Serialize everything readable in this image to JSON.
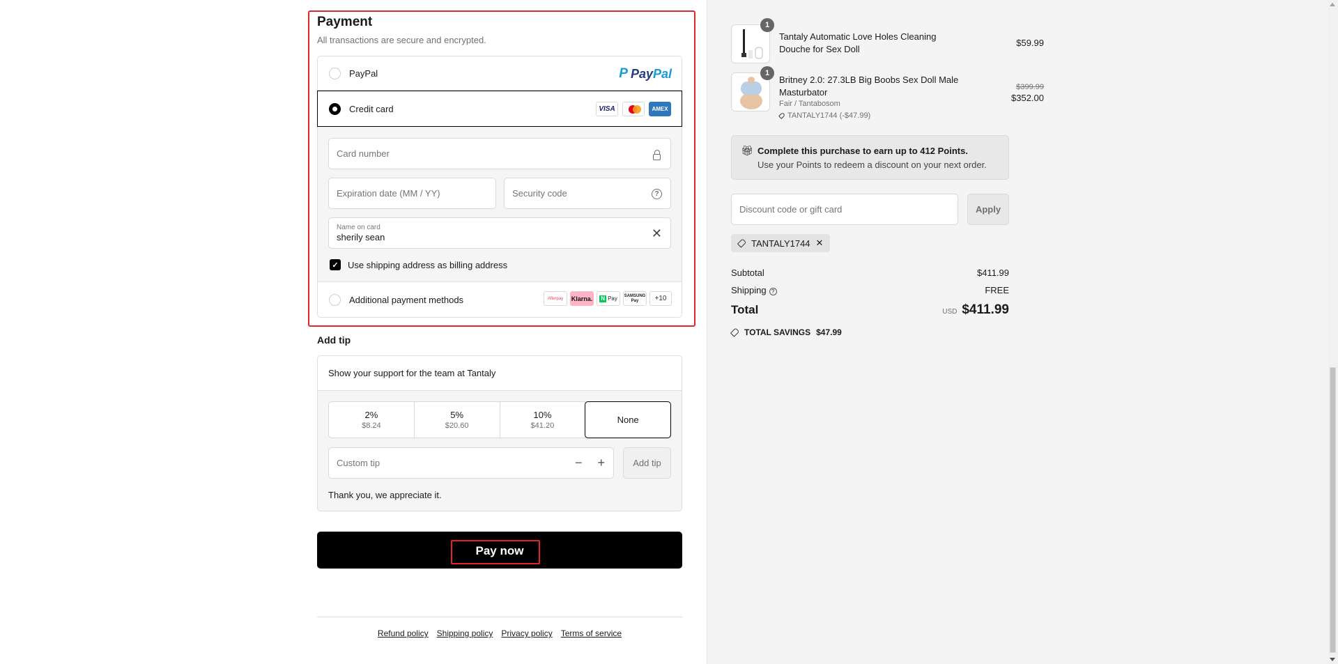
{
  "payment": {
    "title": "Payment",
    "subtitle": "All transactions are secure and encrypted.",
    "methods": {
      "paypal": {
        "label": "PayPal",
        "logo_text_pay": "Pay",
        "logo_text_pal": "Pal"
      },
      "credit_card": {
        "label": "Credit card",
        "selected": true,
        "card_logos": [
          "VISA",
          "mastercard",
          "AMEX"
        ]
      },
      "additional": {
        "label": "Additional payment methods",
        "logos": [
          "Afterpay",
          "Klarna.",
          "Pay",
          "SAMSUNG Pay",
          "+10"
        ]
      }
    },
    "fields": {
      "card_number_placeholder": "Card number",
      "expiration_placeholder": "Expiration date (MM / YY)",
      "security_placeholder": "Security code",
      "name_label": "Name on card",
      "name_value": "sherily sean"
    },
    "billing_checkbox_label": "Use shipping address as billing address",
    "billing_checked": true
  },
  "tip": {
    "title": "Add tip",
    "support_text": "Show your support for the team at Tantaly",
    "options": [
      {
        "pct": "2%",
        "amount": "$8.24"
      },
      {
        "pct": "5%",
        "amount": "$20.60"
      },
      {
        "pct": "10%",
        "amount": "$41.20"
      },
      {
        "pct": "None",
        "amount": ""
      }
    ],
    "selected": "None",
    "custom_placeholder": "Custom tip",
    "add_button": "Add tip",
    "thanks": "Thank you, we appreciate it."
  },
  "pay_button": "Pay now",
  "footer_links": [
    "Refund policy",
    "Shipping policy",
    "Privacy policy",
    "Terms of service"
  ],
  "summary": {
    "items": [
      {
        "qty": "1",
        "name": "Tantaly Automatic Love Holes Cleaning Douche for Sex Doll",
        "price": "$59.99"
      },
      {
        "qty": "1",
        "name": "Britney 2.0: 27.3LB Big Boobs Sex Doll Male Masturbator",
        "variant": "Fair / Tantabosom",
        "discount": "TANTALY1744 (-$47.99)",
        "original_price": "$399.99",
        "price": "$352.00"
      }
    ],
    "points_title": "Complete this purchase to earn up to 412 Points.",
    "points_sub": "Use your Points to redeem a discount on your next order.",
    "discount_placeholder": "Discount code or gift card",
    "apply_label": "Apply",
    "applied_code": "TANTALY1744",
    "subtotal_label": "Subtotal",
    "subtotal": "$411.99",
    "shipping_label": "Shipping",
    "shipping": "FREE",
    "total_label": "Total",
    "currency": "USD",
    "total": "$411.99",
    "savings_label": "TOTAL SAVINGS",
    "savings": "$47.99"
  }
}
